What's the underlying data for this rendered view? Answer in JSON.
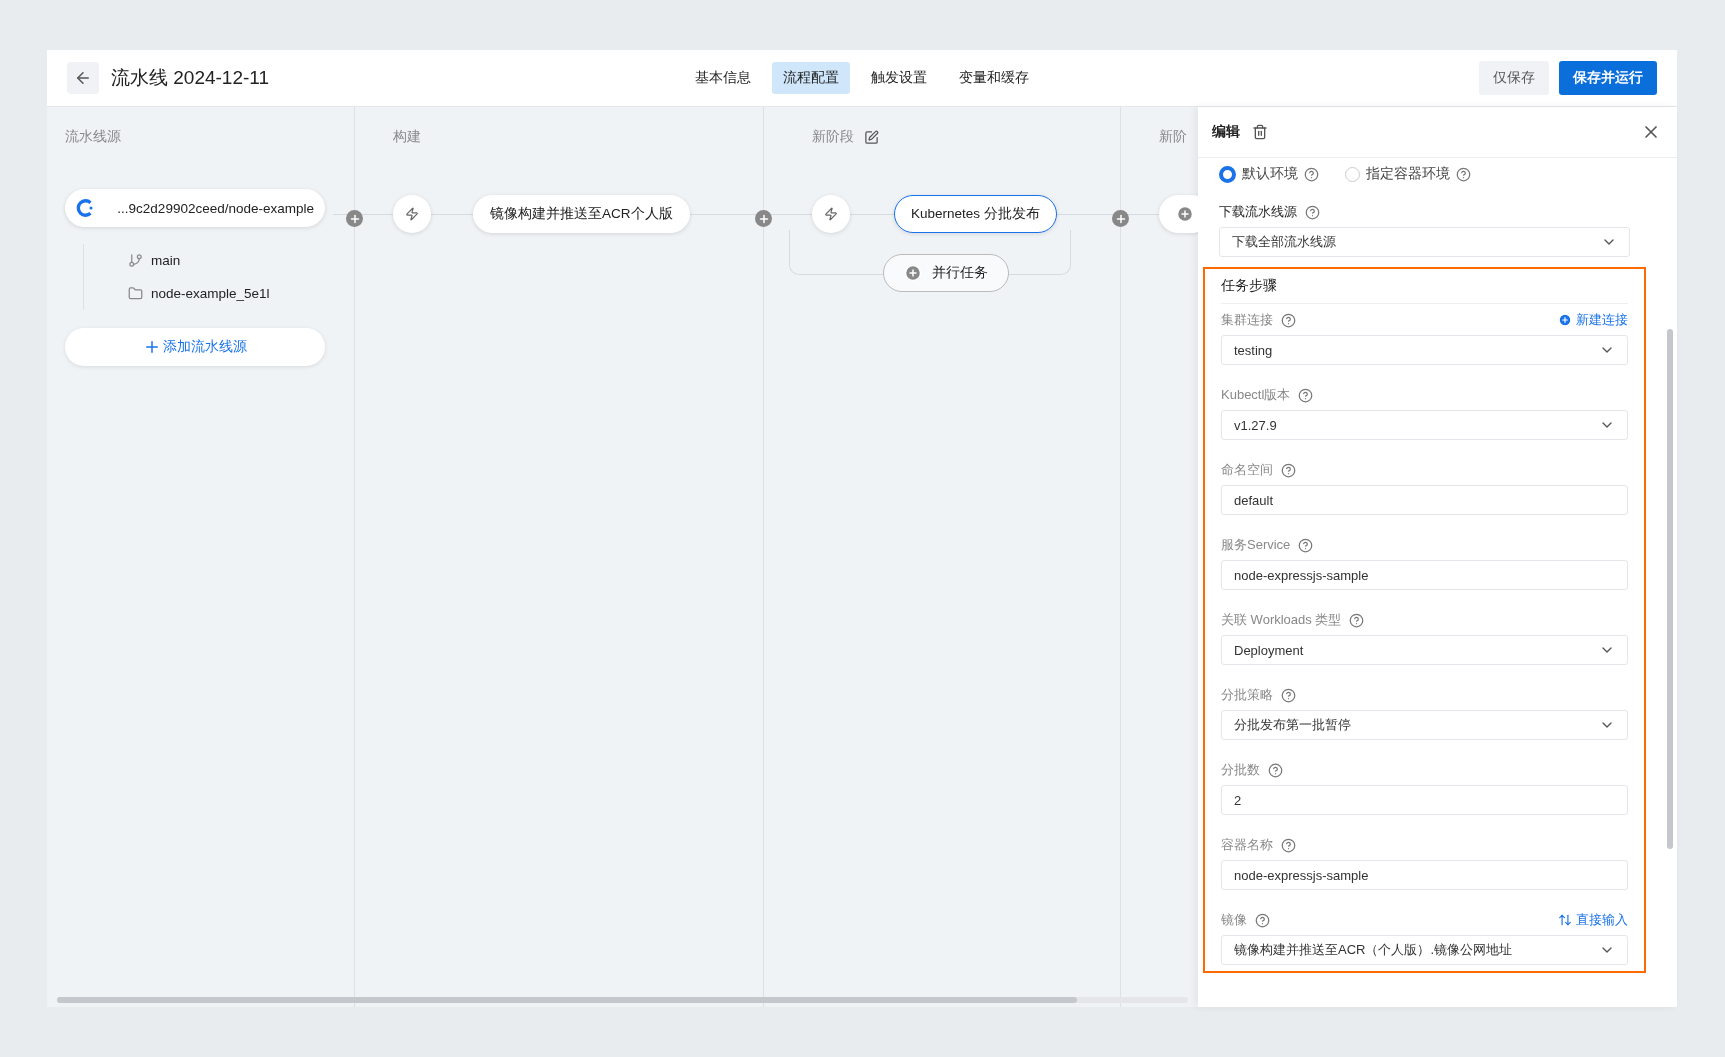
{
  "header": {
    "title": "流水线 2024-12-11",
    "tabs": [
      {
        "label": "基本信息",
        "selected": false
      },
      {
        "label": "流程配置",
        "selected": true
      },
      {
        "label": "触发设置",
        "selected": false
      },
      {
        "label": "变量和缓存",
        "selected": false
      }
    ],
    "buttons": [
      {
        "label": "仅保存",
        "kind": "secondary"
      },
      {
        "label": "保存并运行",
        "kind": "primary"
      }
    ]
  },
  "canvas": {
    "source_column": {
      "title": "流水线源",
      "source": {
        "name": "...9c2d29902ceed/node-example",
        "branch": "main",
        "folder": "node-example_5e1l"
      },
      "add_button": "添加流水线源"
    },
    "stages": [
      {
        "kind": "stage",
        "title": "构建",
        "editable": false,
        "tasks": [
          {
            "label": "镜像构建并推送至ACR个人版",
            "selected": false
          }
        ]
      },
      {
        "kind": "stage",
        "title": "新阶段",
        "editable": true,
        "tasks": [
          {
            "label": "Kubernetes 分批发布",
            "selected": true
          }
        ],
        "parallel_button": "并行任务"
      },
      {
        "kind": "add",
        "title": "新阶"
      }
    ]
  },
  "panel": {
    "title": "编辑",
    "environments": [
      {
        "label": "默认环境",
        "selected": true
      },
      {
        "label": "指定容器环境",
        "selected": false
      }
    ],
    "download": {
      "label": "下载流水线源",
      "value": "下载全部流水线源"
    },
    "section": {
      "title": "任务步骤",
      "highlighted": true,
      "fields": [
        {
          "label": "集群连接",
          "kind": "select",
          "value": "testing",
          "action": {
            "kind": "add",
            "label": "新建连接"
          }
        },
        {
          "label": "Kubectl版本",
          "kind": "select",
          "value": "v1.27.9"
        },
        {
          "label": "命名空间",
          "kind": "input",
          "value": "default"
        },
        {
          "label": "服务Service",
          "kind": "input",
          "value": "node-expressjs-sample"
        },
        {
          "label": "关联 Workloads 类型",
          "kind": "select",
          "value": "Deployment"
        },
        {
          "label": "分批策略",
          "kind": "select",
          "value": "分批发布第一批暂停"
        },
        {
          "label": "分批数",
          "kind": "input",
          "value": "2"
        },
        {
          "label": "容器名称",
          "kind": "input",
          "value": "node-expressjs-sample"
        },
        {
          "label": "镜像",
          "kind": "select",
          "value": "镜像构建并推送至ACR（个人版）.镜像公网地址",
          "action": {
            "kind": "switch",
            "label": "直接输入"
          }
        }
      ]
    }
  }
}
